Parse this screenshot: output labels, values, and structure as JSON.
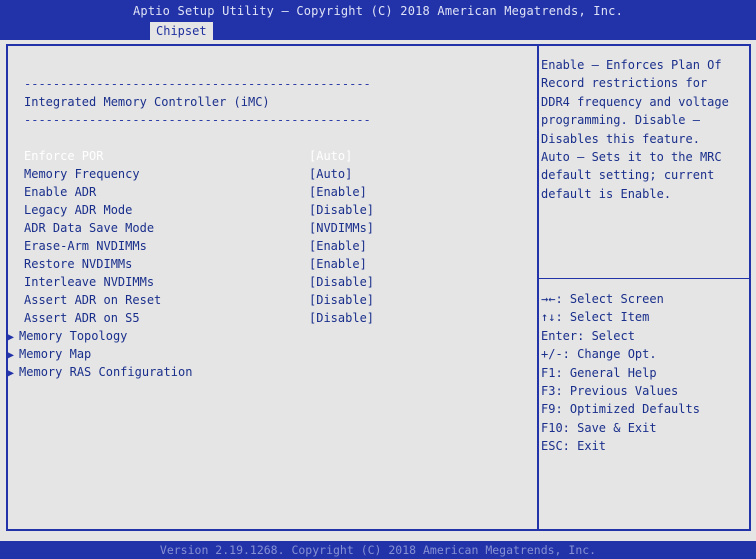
{
  "header": {
    "title": "Aptio Setup Utility – Copyright (C) 2018 American Megatrends, Inc.",
    "tab": "Chipset"
  },
  "main": {
    "separator": "------------------------------------------------",
    "heading": "Integrated Memory Controller (iMC)",
    "settings": [
      {
        "label": "Enforce POR",
        "value": "[Auto]"
      },
      {
        "label": "Memory Frequency",
        "value": "[Auto]"
      },
      {
        "label": "Enable ADR",
        "value": "[Enable]"
      },
      {
        "label": "Legacy ADR Mode",
        "value": "[Disable]"
      },
      {
        "label": "ADR Data Save Mode",
        "value": "[NVDIMMs]"
      },
      {
        "label": "Erase-Arm NVDIMMs",
        "value": "[Enable]"
      },
      {
        "label": "Restore NVDIMMs",
        "value": "[Enable]"
      },
      {
        "label": "Interleave NVDIMMs",
        "value": "[Disable]"
      },
      {
        "label": "Assert ADR on Reset",
        "value": "[Disable]"
      },
      {
        "label": "Assert ADR on S5",
        "value": "[Disable]"
      }
    ],
    "submenus": [
      {
        "label": "Memory Topology"
      },
      {
        "label": "Memory Map"
      },
      {
        "label": "Memory RAS Configuration"
      }
    ]
  },
  "help": {
    "text": "Enable – Enforces Plan Of\nRecord restrictions for\nDDR4 frequency and voltage\nprogramming. Disable –\nDisables this feature.\nAuto – Sets it to the MRC\ndefault setting; current\ndefault is Enable.",
    "keys": [
      "→←: Select Screen",
      "↑↓: Select Item",
      "Enter: Select",
      "+/-: Change Opt.",
      "F1: General Help",
      "F3: Previous Values",
      "F9: Optimized Defaults",
      "F10: Save & Exit",
      "ESC: Exit"
    ]
  },
  "footer": {
    "text": "Version 2.19.1268. Copyright (C) 2018 American Megatrends, Inc."
  },
  "colors": {
    "bar": "#2232a8",
    "background": "#e5e5e5",
    "text": "#1a2f8c",
    "selected_text": "#ffffff"
  }
}
